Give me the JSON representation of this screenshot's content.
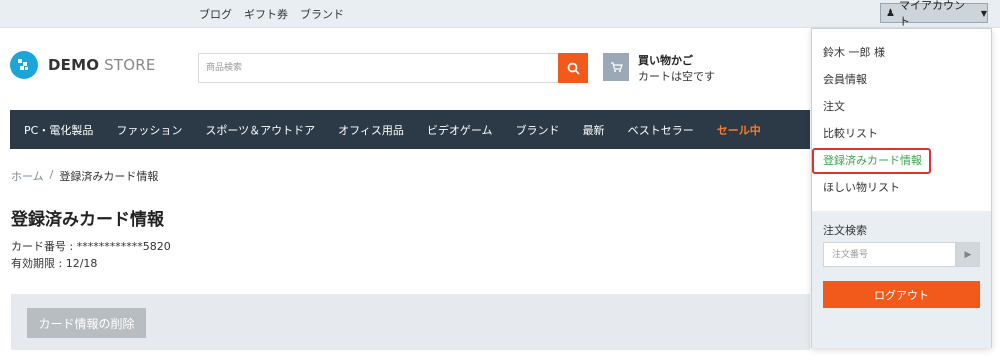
{
  "topbar": {
    "links": [
      "ブログ",
      "ギフト券",
      "ブランド"
    ],
    "account_label": "マイアカウント"
  },
  "header": {
    "logo_bold": "DEMO",
    "logo_light": " STORE",
    "search_placeholder": "商品検索",
    "cart_title": "買い物かご",
    "cart_status": "カートは空です"
  },
  "nav": {
    "items": [
      "PC・電化製品",
      "ファッション",
      "スポーツ＆アウトドア",
      "オフィス用品",
      "ビデオゲーム",
      "ブランド",
      "最新",
      "ベストセラー",
      "セール中"
    ]
  },
  "breadcrumb": {
    "home": "ホーム",
    "separator": "/",
    "current": "登録済みカード情報"
  },
  "main": {
    "title": "登録済みカード情報",
    "card_number": "カード番号 : ************5820",
    "expiry": "有効期限 : 12/18",
    "delete_label": "カード情報の削除"
  },
  "dropdown": {
    "greeting": "鈴木 一郎 様",
    "items": [
      "会員情報",
      "注文",
      "比較リスト",
      "登録済みカード情報",
      "ほしい物リスト"
    ],
    "active_index": 3,
    "order_search_label": "注文検索",
    "order_placeholder": "注文番号",
    "logout_label": "ログアウト"
  },
  "colors": {
    "accent": "#f25a1c",
    "nav_bg": "#2b3a46",
    "sale": "#ff7a23",
    "active_item": "#3aa64a",
    "highlight_border": "#e0302f"
  },
  "icons": {
    "account": "person-icon",
    "dropdown": "caret-down-icon",
    "search": "search-icon",
    "cart": "cart-icon",
    "go": "arrow-right-icon"
  }
}
